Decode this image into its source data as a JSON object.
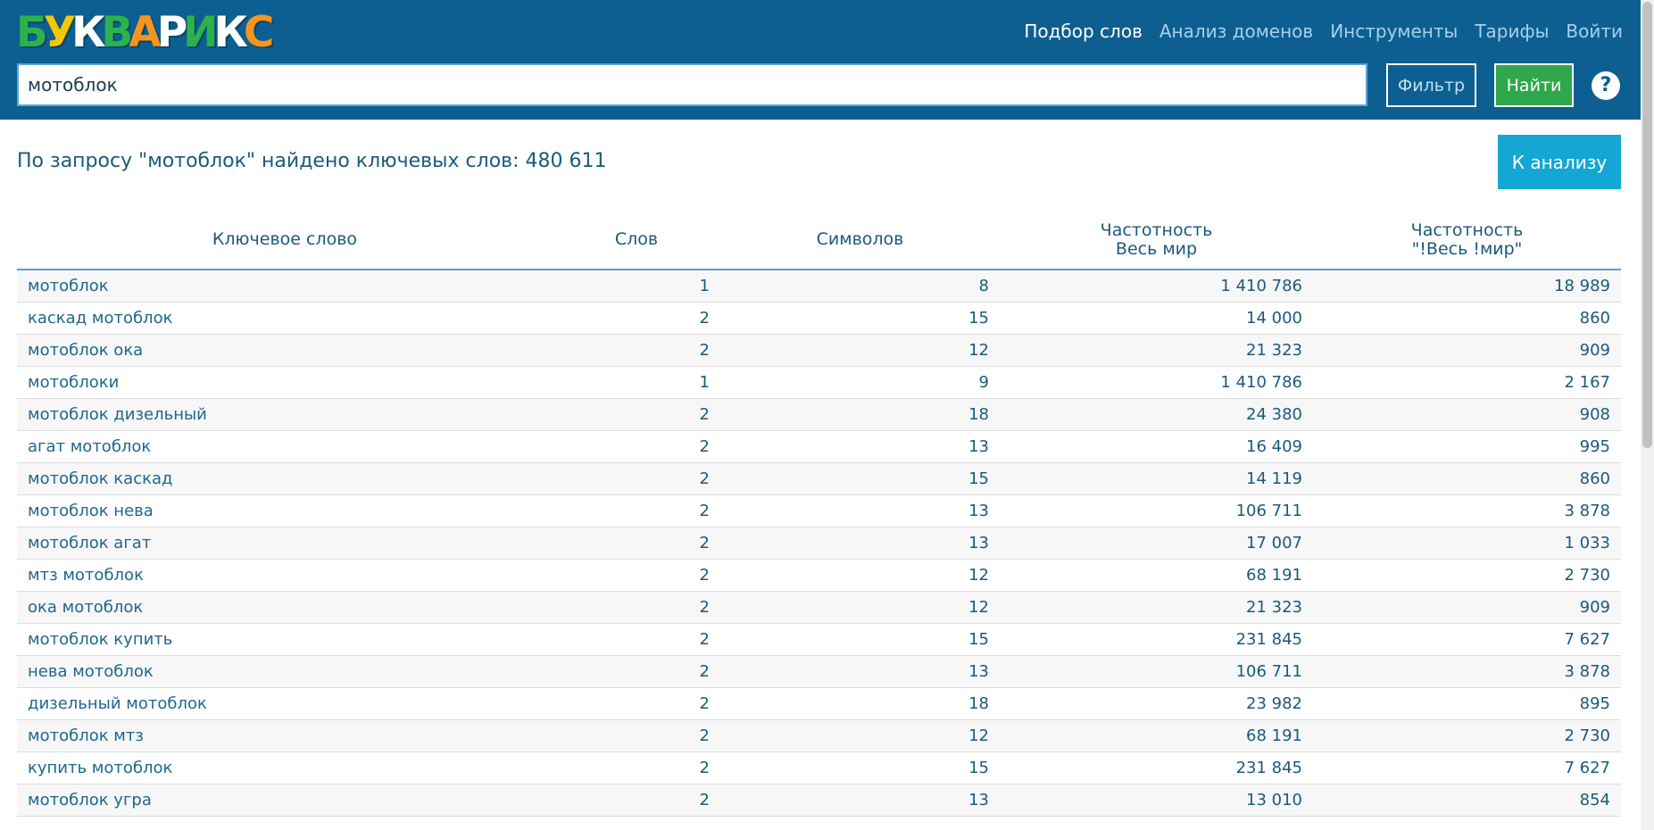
{
  "logo": {
    "letters": [
      {
        "char": "Б",
        "color": "#2bb24c"
      },
      {
        "char": "У",
        "color": "#f5c700"
      },
      {
        "char": "К",
        "color": "#ffffff"
      },
      {
        "char": "В",
        "color": "#2bb24c"
      },
      {
        "char": "А",
        "color": "#f7941d"
      },
      {
        "char": "Р",
        "color": "#ffffff"
      },
      {
        "char": "И",
        "color": "#2bb24c"
      },
      {
        "char": "К",
        "color": "#ffffff"
      },
      {
        "char": "С",
        "color": "#f7941d"
      }
    ]
  },
  "nav": {
    "items": [
      "Подбор слов",
      "Анализ доменов",
      "Инструменты",
      "Тарифы",
      "Войти"
    ],
    "active_index": 0
  },
  "search": {
    "value": "мотоблок",
    "filter_label": "Фильтр",
    "find_label": "Найти",
    "help_label": "?"
  },
  "result": {
    "title": "По запросу \"мотоблок\" найдено ключевых слов: 480 611",
    "analyze_label": "К анализу"
  },
  "table": {
    "headers": {
      "keyword": "Ключевое слово",
      "words": "Слов",
      "chars": "Символов",
      "freq_world_line1": "Частотность",
      "freq_world_line2": "Весь мир",
      "freq_exact_line1": "Частотность",
      "freq_exact_line2": "\"!Весь !мир\""
    },
    "rows": [
      {
        "keyword": "мотоблок",
        "words": "1",
        "chars": "8",
        "freq": "1 410 786",
        "exact": "18 989"
      },
      {
        "keyword": "каскад мотоблок",
        "words": "2",
        "chars": "15",
        "freq": "14 000",
        "exact": "860"
      },
      {
        "keyword": "мотоблок ока",
        "words": "2",
        "chars": "12",
        "freq": "21 323",
        "exact": "909"
      },
      {
        "keyword": "мотоблоки",
        "words": "1",
        "chars": "9",
        "freq": "1 410 786",
        "exact": "2 167"
      },
      {
        "keyword": "мотоблок дизельный",
        "words": "2",
        "chars": "18",
        "freq": "24 380",
        "exact": "908"
      },
      {
        "keyword": "агат мотоблок",
        "words": "2",
        "chars": "13",
        "freq": "16 409",
        "exact": "995"
      },
      {
        "keyword": "мотоблок каскад",
        "words": "2",
        "chars": "15",
        "freq": "14 119",
        "exact": "860"
      },
      {
        "keyword": "мотоблок нева",
        "words": "2",
        "chars": "13",
        "freq": "106 711",
        "exact": "3 878"
      },
      {
        "keyword": "мотоблок агат",
        "words": "2",
        "chars": "13",
        "freq": "17 007",
        "exact": "1 033"
      },
      {
        "keyword": "мтз мотоблок",
        "words": "2",
        "chars": "12",
        "freq": "68 191",
        "exact": "2 730"
      },
      {
        "keyword": "ока мотоблок",
        "words": "2",
        "chars": "12",
        "freq": "21 323",
        "exact": "909"
      },
      {
        "keyword": "мотоблок купить",
        "words": "2",
        "chars": "15",
        "freq": "231 845",
        "exact": "7 627"
      },
      {
        "keyword": "нева мотоблок",
        "words": "2",
        "chars": "13",
        "freq": "106 711",
        "exact": "3 878"
      },
      {
        "keyword": "дизельный мотоблок",
        "words": "2",
        "chars": "18",
        "freq": "23 982",
        "exact": "895"
      },
      {
        "keyword": "мотоблок мтз",
        "words": "2",
        "chars": "12",
        "freq": "68 191",
        "exact": "2 730"
      },
      {
        "keyword": "купить мотоблок",
        "words": "2",
        "chars": "15",
        "freq": "231 845",
        "exact": "7 627"
      },
      {
        "keyword": "мотоблок угра",
        "words": "2",
        "chars": "13",
        "freq": "13 010",
        "exact": "854"
      }
    ]
  },
  "colors": {
    "header_bg": "#0d5f91",
    "find_button": "#2ea84a",
    "analyze_button": "#14a7d4",
    "text": "#1a5a7e"
  }
}
